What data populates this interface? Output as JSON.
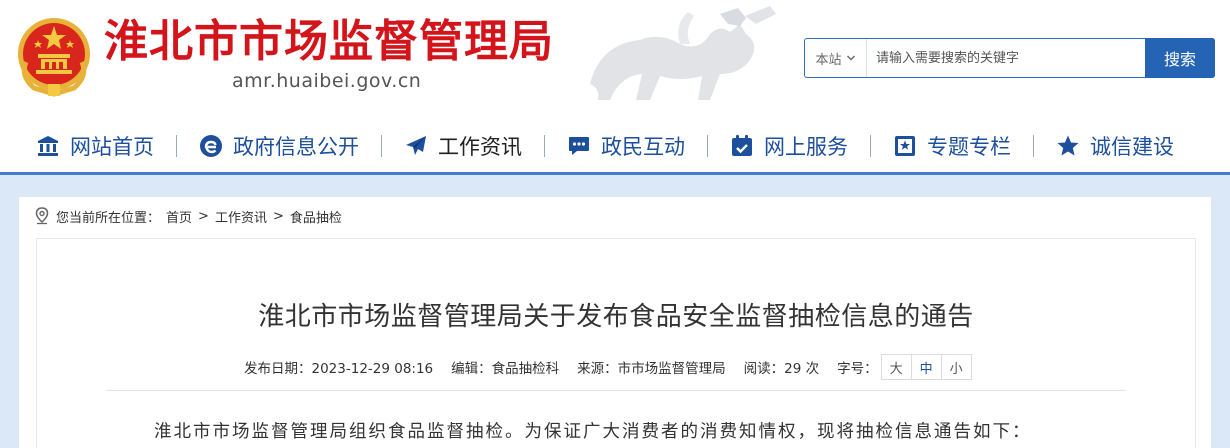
{
  "header": {
    "site_title": "淮北市市场监督管理局",
    "domain": "amr.huaibei.gov.cn",
    "emblem_icon": "national-emblem-icon",
    "brand_color": "#d4141b"
  },
  "search": {
    "scope": "本站",
    "placeholder": "请输入需要搜索的关键字",
    "button_label": "搜索"
  },
  "nav": {
    "items": [
      {
        "label": "网站首页",
        "icon": "bank-icon"
      },
      {
        "label": "政府信息公开",
        "icon": "e-icon"
      },
      {
        "label": "工作资讯",
        "icon": "paper-plane-icon"
      },
      {
        "label": "政民互动",
        "icon": "chat-icon"
      },
      {
        "label": "网上服务",
        "icon": "calendar-check-icon"
      },
      {
        "label": "专题专栏",
        "icon": "bookmark-icon"
      },
      {
        "label": "诚信建设",
        "icon": "star-icon"
      }
    ],
    "active_index": 2,
    "accent_color": "#1d4f9c"
  },
  "breadcrumb": {
    "prefix": "您当前所在位置：",
    "items": [
      "首页",
      "工作资讯",
      "食品抽检"
    ],
    "separator": ">"
  },
  "article": {
    "title": "淮北市市场监督管理局关于发布食品安全监督抽检信息的通告",
    "meta": {
      "date": "发布日期：2023-12-29 08:16",
      "editor": "编辑：食品抽检科",
      "source": "来源：市市场监督管理局",
      "views": "阅读：29 次",
      "font_size_label": "字号：",
      "font_sizes": [
        "大",
        "中",
        "小"
      ],
      "active_font_size": "中"
    },
    "first_paragraph": "淮北市市场监督管理局组织食品监督抽检。为保证广大消费者的消费知情权，现将抽检信息通告如下："
  }
}
